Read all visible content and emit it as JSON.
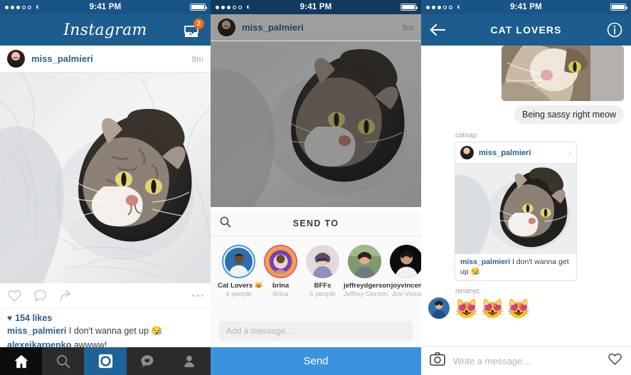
{
  "status_bar": {
    "time": "9:41 PM",
    "signal_dots_filled": 3,
    "signal_dots_total": 5,
    "wifi_icon": "wifi-icon",
    "battery_icon": "battery-full-icon"
  },
  "panel_feed": {
    "nav": {
      "logo_text": "Instagram",
      "inbox_icon": "inbox-tray-icon",
      "inbox_badge": "2"
    },
    "post": {
      "username": "miss_palmieri",
      "timestamp": "8m",
      "avatar_icon": "user-avatar",
      "photo_alt": "tabby cat curled up on white bed sheets",
      "actions": {
        "like_icon": "heart-outline-icon",
        "comment_icon": "comment-bubble-icon",
        "share_icon": "share-arrow-icon",
        "more_icon": "more-options-icon"
      },
      "likes_text": "154 likes",
      "likes_heart_icon": "heart-filled-icon",
      "comments": [
        {
          "user": "miss_palmieri",
          "text": "I don't wanna get up 😪"
        },
        {
          "user": "alexeikarpenko",
          "text": "awwww!"
        }
      ]
    },
    "tabbar": [
      {
        "name": "home",
        "icon": "home-icon",
        "active": true
      },
      {
        "name": "search",
        "icon": "search-icon",
        "active": false
      },
      {
        "name": "camera",
        "icon": "camera-shutter-icon",
        "active": true
      },
      {
        "name": "activity",
        "icon": "activity-heart-icon",
        "active": false
      },
      {
        "name": "profile",
        "icon": "person-icon",
        "active": false
      }
    ]
  },
  "panel_share": {
    "post": {
      "username": "miss_palmieri",
      "timestamp": "8m"
    },
    "sheet": {
      "search_icon": "search-icon",
      "title": "SEND TO",
      "recipients": [
        {
          "name": "Cat Lovers 🐱",
          "sub": "4 people",
          "selected": true
        },
        {
          "name": "brina",
          "sub": "Brina",
          "selected": false
        },
        {
          "name": "BFFs",
          "sub": "5 people",
          "selected": false
        },
        {
          "name": "jeffreydgerson",
          "sub": "Jeffrey Gerson",
          "selected": false
        },
        {
          "name": "joyvincen",
          "sub": "Joy-Vince",
          "selected": false
        }
      ],
      "message_placeholder": "Add a message…",
      "send_label": "Send"
    }
  },
  "panel_chat": {
    "nav": {
      "back_icon": "back-arrow-icon",
      "title": "CAT LOVERS",
      "info_icon": "info-circle-icon"
    },
    "messages": [
      {
        "type": "image",
        "alt": "close up of tabby cat face",
        "align": "right"
      },
      {
        "type": "text",
        "text": "Being sassy right meow",
        "align": "right"
      },
      {
        "type": "post",
        "sender": "catnap",
        "post_username": "miss_palmieri",
        "chevron_icon": "chevron-right-icon",
        "caption_user": "miss_palmieri",
        "caption_text": "I don't wanna get up 😪"
      },
      {
        "type": "emoji",
        "sender": "ninanyc",
        "emoji": "😻😻😻"
      }
    ],
    "composer": {
      "camera_icon": "camera-icon",
      "placeholder": "Write a message…",
      "like_icon": "heart-outline-icon"
    }
  },
  "colors": {
    "navy": "#1d5c8f",
    "status_navy": "#1a5486",
    "blue_link": "#2d5f8a",
    "send_blue": "#3b93e0",
    "badge_orange": "#e8701a",
    "ring_blue": "#3897f0"
  }
}
